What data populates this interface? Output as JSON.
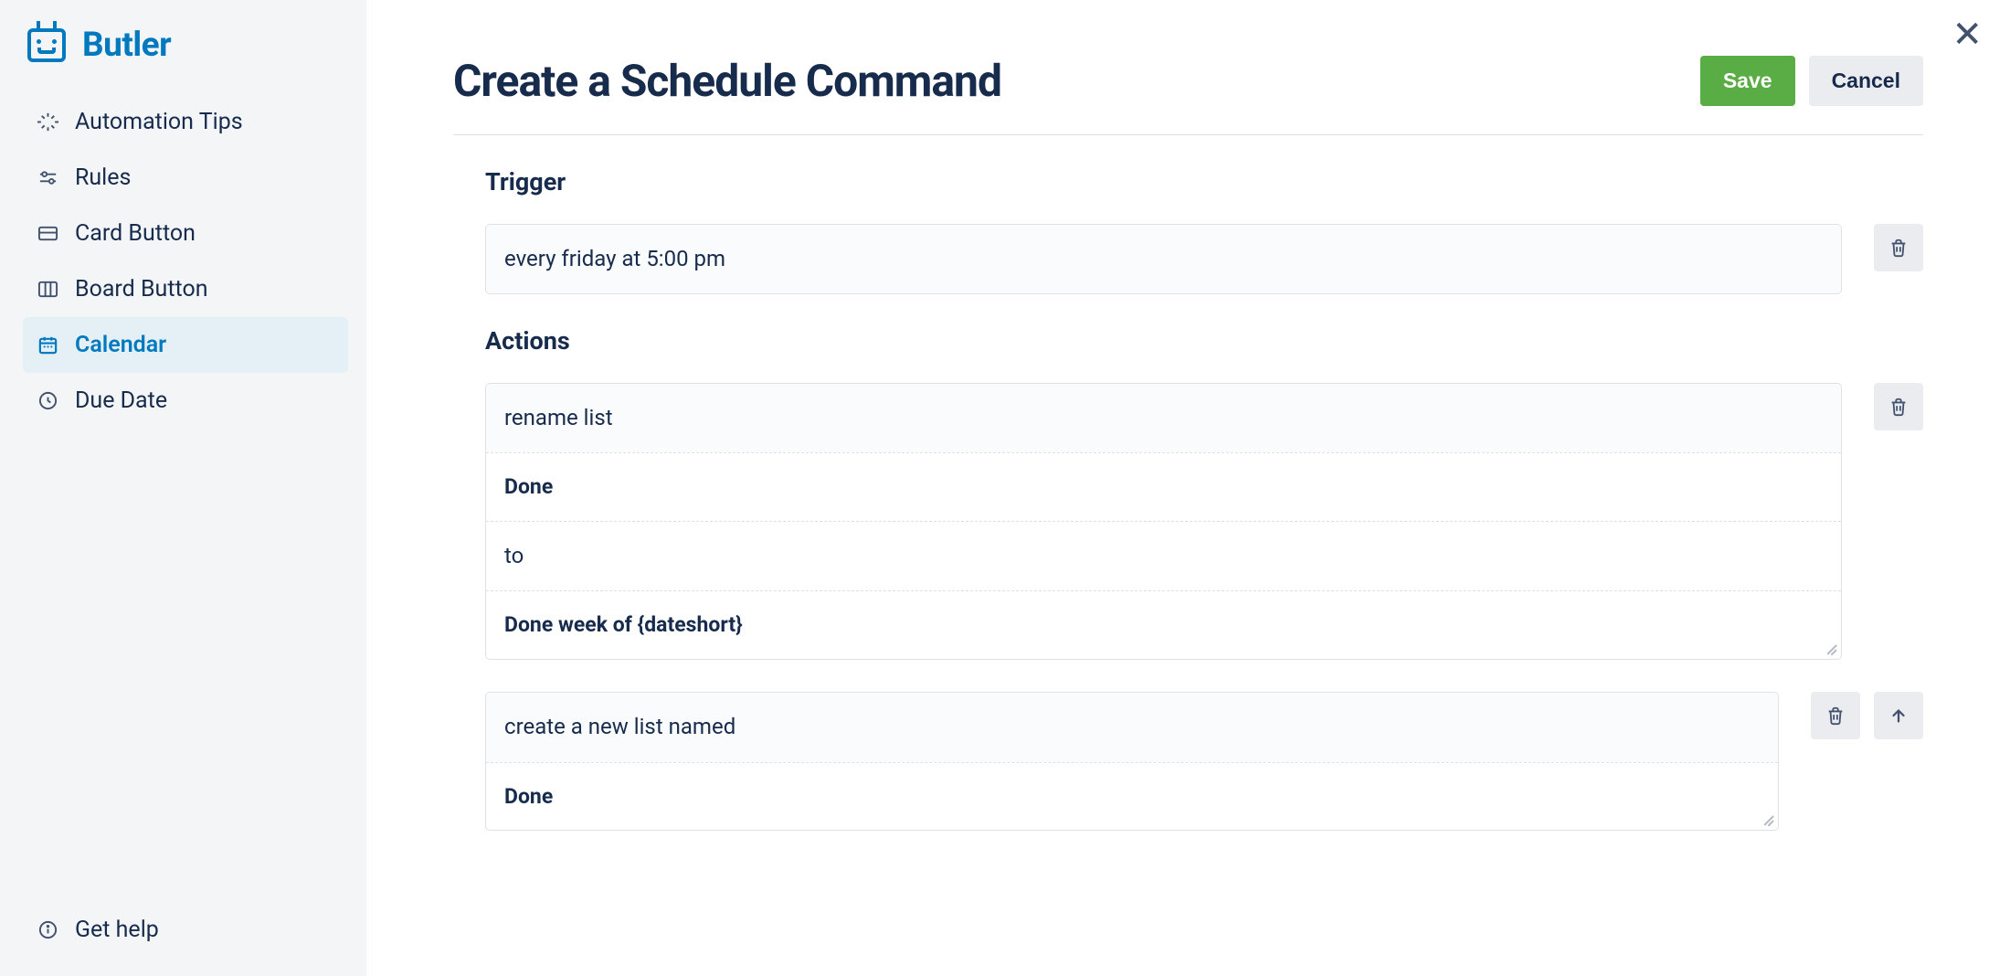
{
  "brand": {
    "name": "Butler"
  },
  "sidebar": {
    "items": [
      {
        "label": "Automation Tips",
        "icon": "sparkle",
        "active": false
      },
      {
        "label": "Rules",
        "icon": "sliders",
        "active": false
      },
      {
        "label": "Card Button",
        "icon": "card",
        "active": false
      },
      {
        "label": "Board Button",
        "icon": "board",
        "active": false
      },
      {
        "label": "Calendar",
        "icon": "calendar",
        "active": true
      },
      {
        "label": "Due Date",
        "icon": "clock",
        "active": false
      }
    ],
    "footer": {
      "label": "Get help",
      "icon": "info"
    }
  },
  "header": {
    "title": "Create a Schedule Command",
    "save_label": "Save",
    "cancel_label": "Cancel"
  },
  "trigger": {
    "section_title": "Trigger",
    "text": "every friday at 5:00 pm"
  },
  "actions": {
    "section_title": "Actions",
    "items": [
      {
        "rows": [
          {
            "text": "rename list",
            "header": true
          },
          {
            "text": "Done",
            "bold": true
          },
          {
            "text": "to"
          },
          {
            "text": "Done week of {dateshort}",
            "bold": true,
            "resizable": true
          }
        ],
        "has_up": false
      },
      {
        "rows": [
          {
            "text": "create a new list named",
            "header": true
          },
          {
            "text": "Done",
            "bold": true,
            "resizable": true
          }
        ],
        "has_up": true
      }
    ]
  }
}
